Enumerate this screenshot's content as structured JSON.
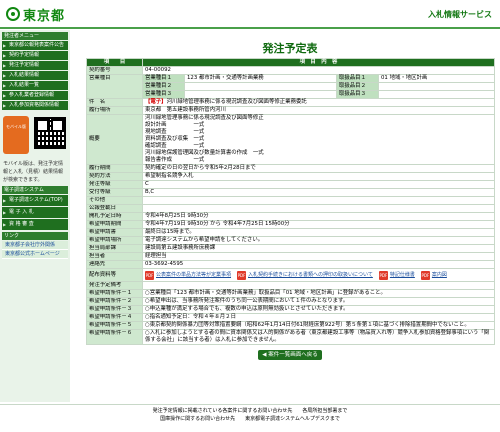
{
  "header": {
    "logo_text": "東京都",
    "service_name": "入札情報サービス"
  },
  "sidebar": {
    "section_title": "発注者メニュー",
    "nav_items": [
      "東京都公報発表案件公告",
      "契約予定情報",
      "発注予定情報",
      "入札結果情報",
      "入札結果一覧",
      "参入札業者登録情報",
      "入札参加資格関係情報"
    ],
    "mobile_label": "モバイル版",
    "mobile_note": "モバイル版は、発注予定情報と入札（見積）結果情報が検索できます。",
    "section2_title": "電子調達システム",
    "nav2_items": [
      "電子調達システム(TOP)",
      "電 子 入 札",
      "資 格 審 査"
    ],
    "section3_title": "リンク",
    "links": [
      "東京都子会社庁外関係",
      "東京都公式ホームページ"
    ]
  },
  "main": {
    "title": "発注予定表",
    "col_item": "項　　目",
    "col_content": "項　目　内　容",
    "contract_no_label": "契約番号",
    "contract_no": "04-00092",
    "business_type_label": "営業種目",
    "business_rows": [
      {
        "k1": "営業種目１",
        "v1": "123 都市計画・交通等計画業務",
        "k2": "取扱品目１",
        "v2": "01 地域・地区計画"
      },
      {
        "k1": "営業種目２",
        "v1": "",
        "k2": "取扱品目２",
        "v2": ""
      },
      {
        "k1": "営業種目３",
        "v1": "",
        "k2": "取扱品目３",
        "v2": ""
      }
    ],
    "subject_label": "件　名",
    "subject_badge": "【電子】",
    "subject": "河川緑地管理事務に係る現況調査及び図面等修正業務委託",
    "location_label": "履行場所",
    "location": "東京都　第五建設事務所管内河川",
    "overview_label": "概要",
    "overview_lines": [
      "河川緑地管理事務に係る現況調査及び図面等修正",
      "設計計画　　　　　一式",
      "現地調査　　　　　一式",
      "資料調査及び収集　一式",
      "確認調査　　　　　一式",
      "河川緑地保護管理図及び数量計算書の作成　一式",
      "報告書作成　　　　一式"
    ],
    "period_label": "履行期間",
    "period": "契約確定の日の翌日から令和5年2月28日まで",
    "method_label": "契約方法",
    "method": "希望制指名競争入札",
    "ordering_type_label": "発注等級",
    "ordering_type": "C",
    "receipt_grade_label": "受付等級",
    "receipt_grade": "B,C",
    "other_label": "その他",
    "other": "",
    "publish_date_label": "公報登載日",
    "publish_date": "",
    "notice_date_label": "開札予定日時",
    "notice_date": "令和4年8月25日 9時30分",
    "application_period_label": "希望申請期間",
    "application_period": "令和4年7月19日 9時30分 から 令和4年7月25日 15時00分",
    "deadline_label": "希望申請書",
    "deadline": "最終日は15時まで。",
    "method2_label": "希望申請場所",
    "method2": "電子調達システムから希望申請をしてください。",
    "office_label": "担当局部課",
    "office": "建設局第五建設事務所庶務課",
    "person_label": "担当者",
    "person": "経理担当",
    "phone_label": "連絡先",
    "phone": "03-3692-4595",
    "docs_label": "配布資料等",
    "docs": [
      "公表案件の単品方法等が定業事項",
      "入札契約手続きにおける書類への押印の取扱いについて",
      "特記仕様書",
      "案内図"
    ],
    "notes_label": "発注予定備考",
    "notes": "",
    "conditions": [
      {
        "label": "希望申請条件－１",
        "text": "○営業種目「123 都市計画・交通等計画業務」取扱品目「01 地域・地区計画」に登録があること。"
      },
      {
        "label": "希望申請条件－２",
        "text": "○希望申出は、当事務所発注案件のうち同一公表期間において１件のみとなります。"
      },
      {
        "label": "希望申請条件－３",
        "text": "○申込業種が満足する場合でも、複数の申込は原則無効扱いとさせていただきます。"
      },
      {
        "label": "希望申請条件－４",
        "text": "○指名通知予定日：令和４年８月２日"
      },
      {
        "label": "希望申請条件－５",
        "text": "○東京都契約関係暴力団等対策措置要綱（昭和62年1月14日付61財経庶第922号）第５条第１項に基づく排除措置期間中でないこと。"
      },
      {
        "label": "希望申請条件－６",
        "text": "○入札に参加しようとする者の間に資本関係又は人的関係がある者（東京都建設工事等（物品買入れ等）競争入札参加資格登録事項にいう「関係する会社」に該当する者）は入札に参加できません。"
      }
    ],
    "back_button": "案件一覧画面へ戻る"
  },
  "footer": {
    "line1": "発注予定情報に掲載されている各案件に関するお問い合わせ先　　各局所担当部署まで",
    "line2": "国庫操作に関するお問い合わせ先　　東京都電子調達システムヘルプデスクまで"
  }
}
